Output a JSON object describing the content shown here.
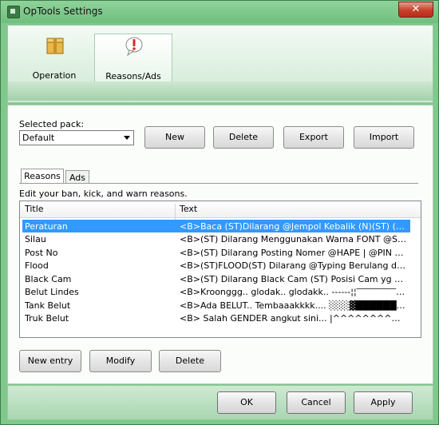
{
  "window": {
    "title": "OpTools Settings",
    "close_glyph": "✕"
  },
  "top_tabs": [
    {
      "label": "Operation",
      "icon": "package-icon"
    },
    {
      "label": "Reasons/Ads",
      "icon": "warning-bubble-icon"
    }
  ],
  "pack": {
    "label": "Selected pack:",
    "value": "Default",
    "buttons": {
      "new": "New",
      "delete": "Delete",
      "export": "Export",
      "import": "Import"
    }
  },
  "sub_tabs": [
    "Reasons",
    "Ads"
  ],
  "hint": "Edit your ban, kick, and warn reasons.",
  "list": {
    "columns": [
      "Title",
      "Text"
    ],
    "rows": [
      {
        "title": "Peraturan",
        "text": "<B>Baca (ST)Dilarang @Jempol Kebalik (N)(ST) (ST)Dilar..."
      },
      {
        "title": "Silau",
        "text": "<B>(ST) Dilarang Menggunakan Warna FONT @Silau (ST..."
      },
      {
        "title": "Post No",
        "text": "<B>(ST) Dilarang Posting Nomer @HAPE | @PIN @BB | ..."
      },
      {
        "title": "Flood",
        "text": "<B>(ST)FLOOD(ST) Dilarang @Typing Berulang dan Keba..."
      },
      {
        "title": "Black Cam",
        "text": "<B>(ST) Dilarang Black Cam (ST) Posisi Cam yg Enak di Li..."
      },
      {
        "title": "Belut Lindes",
        "text": "<B>Kroonggg.. glodak.. glodakk.. ------¦¦‾‾‾‾‾‾‾‾‾‾‾‾‾"
      },
      {
        "title": "Tank Belut",
        "text": "<B>Ada BELUT.. Tembaaakkkk.... ░░░▓████████ ▄▬..."
      },
      {
        "title": "Truk Belut",
        "text": "<B> Salah GENDER angkut sini... |^^^^^^^^^^^^^^^^^..."
      }
    ],
    "selected_index": 0
  },
  "entry_buttons": {
    "new_entry": "New entry",
    "modify": "Modify",
    "delete": "Delete"
  },
  "footer": {
    "ok": "OK",
    "cancel": "Cancel",
    "apply": "Apply"
  },
  "colors": {
    "accent": "#7ec98b",
    "selection": "#3399ff",
    "close": "#c8402b"
  }
}
